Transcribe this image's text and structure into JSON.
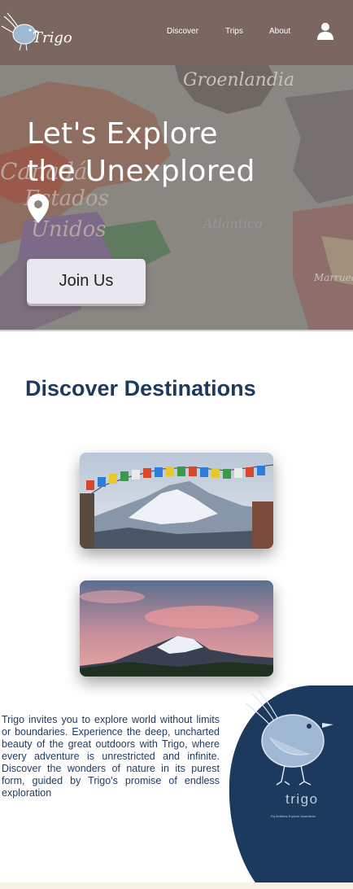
{
  "nav": {
    "logo_text": "Trigo",
    "links": [
      "Discover",
      "Trips",
      "About"
    ]
  },
  "hero": {
    "title_line1": "Let's Explore",
    "title_line2": "the Unexplored",
    "button": "Join Us",
    "map_words": [
      "Groenlandia",
      "Canadá",
      "Estados",
      "Unidos",
      "Atlántico",
      "Marruecos"
    ]
  },
  "discover": {
    "title": "Discover Destinations",
    "cards": [
      {
        "scene": "prayer-flags-mountain"
      },
      {
        "scene": "sunset-mountain"
      }
    ]
  },
  "about": {
    "text": "Trigo invites you to explore world without limits or boundaries. Experience the deep, uncharted beauty of the great outdoors with Trigo, where every adventure is unrestricted and infinite. Discover the wonders of nature in its purest form, guided by Trigo's promise of endless exploration",
    "brand_word": "trigo",
    "brand_tag": "Fly limitless Explore boundless"
  },
  "colors": {
    "nav": "#7a6762",
    "title": "#1c3a5e",
    "blob": "#1c3a5e",
    "button": "#e9e8ee"
  }
}
